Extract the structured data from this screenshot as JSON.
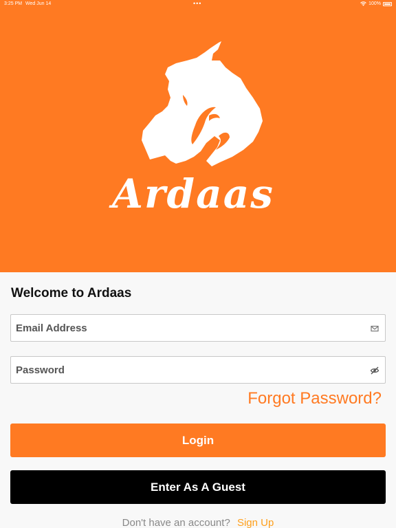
{
  "status_bar": {
    "time": "3:25 PM",
    "date": "Wed Jun 14",
    "battery": "100%"
  },
  "brand": {
    "name": "Ardaas",
    "primary_color": "#ff7a22",
    "signup_link_color": "#ff9f1a"
  },
  "form": {
    "welcome": "Welcome to Ardaas",
    "email_placeholder": "Email Address",
    "email_value": "",
    "password_placeholder": "Password",
    "password_value": "",
    "email_icon": "mail-icon",
    "password_icon": "eye-off-icon",
    "forgot_label": "Forgot Password?",
    "login_label": "Login",
    "guest_label": "Enter As A Guest",
    "signup_prompt": "Don't have an account?",
    "signup_label": "Sign Up"
  }
}
